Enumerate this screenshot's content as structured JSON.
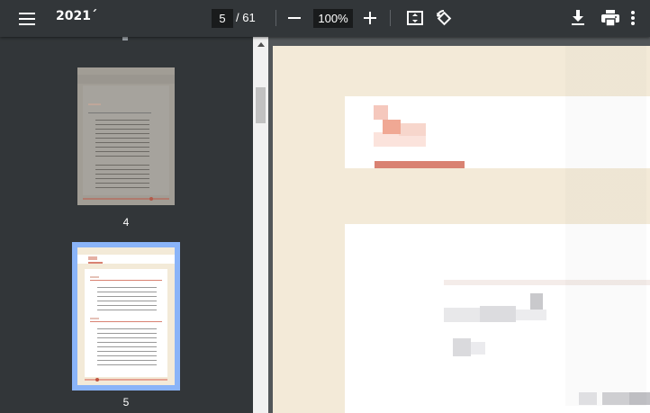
{
  "toolbar": {
    "title": "2021´",
    "current_page": "5",
    "page_total": "/ 61",
    "zoom": "100%"
  },
  "icons": {
    "menu": "hamburger-menu-icon",
    "zoom_out": "minus-icon",
    "zoom_in": "plus-icon",
    "fit": "fit-to-page-icon",
    "rotate": "rotate-icon",
    "download": "download-icon",
    "print": "print-icon",
    "more": "more-vertical-icon"
  },
  "sidebar": {
    "thumbnails": [
      {
        "label": "4"
      },
      {
        "label": "5"
      }
    ]
  },
  "colors": {
    "toolbar_bg": "#323639",
    "viewer_bg": "#525659",
    "page_bg": "#f3ead8",
    "accent": "#d98272",
    "selection": "#8ab4f8"
  }
}
